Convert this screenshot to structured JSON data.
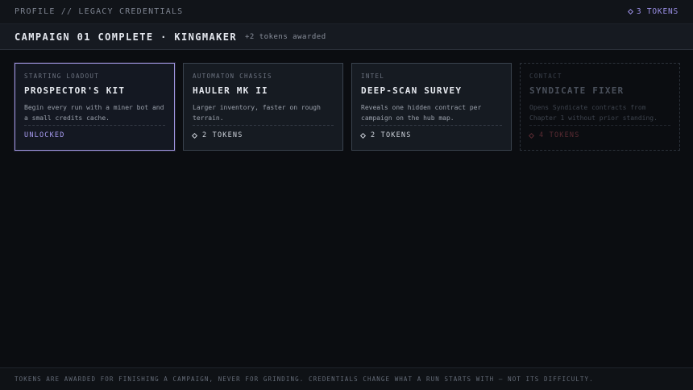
{
  "header": {
    "breadcrumb": "PROFILE // LEGACY CREDENTIALS",
    "tokens": "3 TOKENS"
  },
  "banner": {
    "title": "CAMPAIGN 01 COMPLETE · KINGMAKER",
    "subtitle": "+2 tokens awarded"
  },
  "cards": [
    {
      "category": "STARTING LOADOUT",
      "title": "PROSPECTOR'S KIT",
      "description": "Begin every run with a miner bot and a small credits cache.",
      "status": "UNLOCKED"
    },
    {
      "category": "AUTOMATON CHASSIS",
      "title": "HAULER MK II",
      "description": "Larger inventory, faster on rough terrain.",
      "cost": "2 TOKENS"
    },
    {
      "category": "INTEL",
      "title": "DEEP-SCAN SURVEY",
      "description": "Reveals one hidden contract per campaign on the hub map.",
      "cost": "2 TOKENS"
    },
    {
      "category": "CONTACT",
      "title": "SYNDICATE FIXER",
      "description": "Opens Syndicate contracts from Chapter 1 without prior standing.",
      "cost": "4 TOKENS"
    }
  ],
  "footer": {
    "note": "TOKENS ARE AWARDED FOR FINISHING A CAMPAIGN, NEVER FOR GRINDING. CREDENTIALS CHANGE WHAT A RUN STARTS WITH — NOT ITS DIFFICULTY."
  },
  "colors": {
    "accent": "#9f95e0",
    "background": "#0b0d11",
    "locked_cost": "#5a2b33"
  },
  "icons": {
    "token": "diamond-token-icon"
  }
}
